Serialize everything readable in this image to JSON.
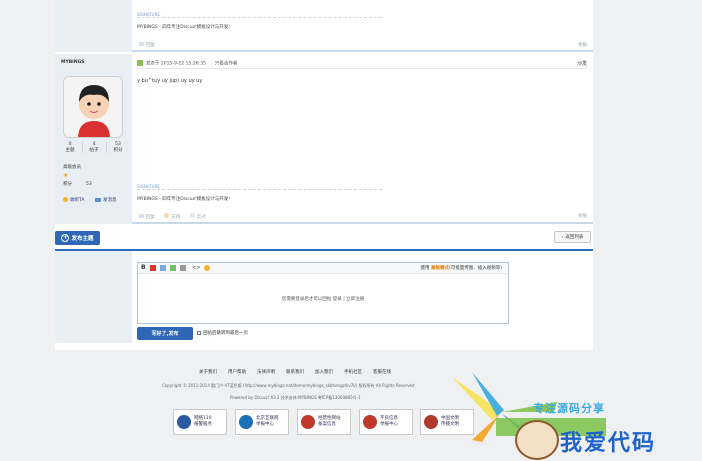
{
  "post_top": {
    "signature_label": "SIGNATURE",
    "signature_text": "MYBINGS - 四年专注Discuz!模板设计与开发!",
    "reply_label": "回复",
    "report_label": "举报"
  },
  "post2": {
    "username": "MYBINGS",
    "stats": [
      {
        "value": "0",
        "label": "主题"
      },
      {
        "value": "4",
        "label": "帖子"
      },
      {
        "value": "53",
        "label": "积分"
      }
    ],
    "rank": "高级会员",
    "credit_label": "积分",
    "credit_value": "53",
    "favorite_label": "收听TA",
    "message_label": "发消息",
    "posted_at": "发表于 2015-9-22 15:26:35",
    "only_author": "只看该作者",
    "floor": "沙发",
    "body_text": "y bu^tuy uy jup) uy uy uy",
    "signature_label": "SIGNATURE",
    "signature_text": "MYBINGS - 四年专注Discuz!模板设计与开发!",
    "reply_label": "回复",
    "support_label": "支持",
    "oppose_label": "反对",
    "report_label": "举报"
  },
  "actions": {
    "new_topic": "发布主题",
    "back_to_list": "返回列表"
  },
  "editor": {
    "mode_prefix": "使用",
    "mode_label": "高级模式",
    "mode_suffix": "(可批量传图、插入视频等)",
    "login_prompt": "您需要登录后才可以回帖 登录 | 立即注册",
    "submit": "写好了,发布",
    "checkbox_label": "回帖后跳转到最后一页"
  },
  "footer": {
    "links": [
      "关于我们",
      "用户帮助",
      "法律声明",
      "联系我们",
      "加入我们",
      "手机社区",
      "客服在线"
    ],
    "copyright": "Copyright © 2011-2014 酷门户-VT蓝色版 (http://www.mybings.net/demo/mybings_skbhengzhiv7l/) 版权所有 All Rights Reserved",
    "powered": "Powered by Discuz! X3.2 技术支持:MYBINGS 粤ICP备13000885号-1",
    "badges": [
      {
        "line1": "网络110",
        "line2": "报警服务",
        "color": "#2c5aa0"
      },
      {
        "line1": "北京互联网",
        "line2": "举报中心",
        "color": "#1d6fb5"
      },
      {
        "line1": "经营性网站",
        "line2": "备案信息",
        "color": "#c0392b"
      },
      {
        "line1": "不良信息",
        "line2": "举报中心",
        "color": "#c0392b"
      },
      {
        "line1": "中国文明",
        "line2": "传播文明",
        "color": "#b03a2e"
      }
    ]
  },
  "watermark": {
    "tagline": "专注源码分享",
    "brand": "我爱代码"
  }
}
